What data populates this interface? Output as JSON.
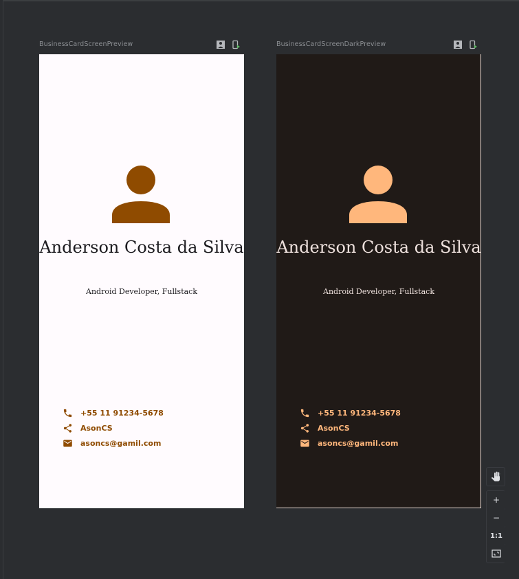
{
  "previews": [
    {
      "label": "BusinessCardScreenPreview",
      "theme": "light",
      "name": "Anderson Costa da Silva",
      "role": "Android Developer, Fullstack",
      "contacts": {
        "phone": "+55 11 91234-5678",
        "share": "AsonCS",
        "email": "asoncs@gamil.com"
      },
      "colors": {
        "accent": "#8f4b00",
        "background": "#fffbfe",
        "text": "#1c1b1f"
      }
    },
    {
      "label": "BusinessCardScreenDarkPreview",
      "theme": "dark",
      "name": "Anderson Costa da Silva",
      "role": "Android Developer, Fullstack",
      "contacts": {
        "phone": "+55 11 91234-5678",
        "share": "AsonCS",
        "email": "asoncs@gamil.com"
      },
      "colors": {
        "accent": "#ffb77c",
        "background": "#201a17",
        "text": "#ede0dc"
      }
    }
  ],
  "toolbar": {
    "pan_icon": "hand-icon",
    "zoom_in": "+",
    "zoom_out": "−",
    "actual_size": "1:1",
    "fit_icon": "fit-screen-icon"
  }
}
